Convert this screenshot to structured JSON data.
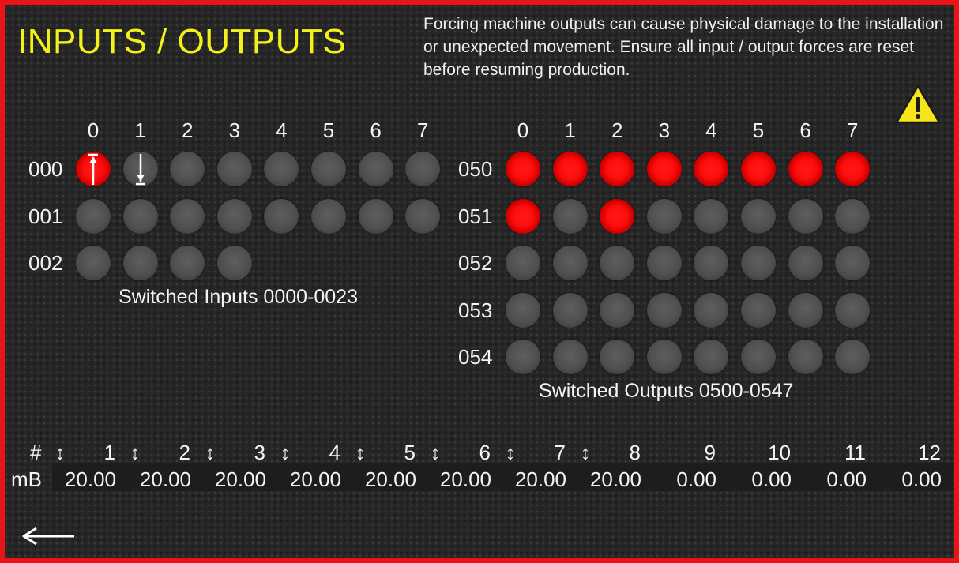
{
  "title": "INPUTS / OUTPUTS",
  "warning": "Forcing machine outputs can cause physical damage to the installation or unexpected movement. Ensure all input / output forces are reset before resuming production.",
  "warning_icon": "warning-triangle-icon",
  "colors": {
    "frame": "#e8141a",
    "title": "#f2f21a",
    "led_on": "#ff0d0d",
    "led_off": "#555555"
  },
  "inputs": {
    "columns": [
      "0",
      "1",
      "2",
      "3",
      "4",
      "5",
      "6",
      "7"
    ],
    "rows": [
      {
        "label": "000",
        "states": [
          1,
          0,
          0,
          0,
          0,
          0,
          0,
          0
        ],
        "forces": [
          "up",
          "down",
          null,
          null,
          null,
          null,
          null,
          null
        ]
      },
      {
        "label": "001",
        "states": [
          0,
          0,
          0,
          0,
          0,
          0,
          0,
          0
        ],
        "forces": [
          null,
          null,
          null,
          null,
          null,
          null,
          null,
          null
        ]
      },
      {
        "label": "002",
        "states": [
          0,
          0,
          0,
          0
        ],
        "forces": [
          null,
          null,
          null,
          null
        ]
      }
    ],
    "caption": "Switched Inputs 0000-0023"
  },
  "outputs": {
    "columns": [
      "0",
      "1",
      "2",
      "3",
      "4",
      "5",
      "6",
      "7"
    ],
    "rows": [
      {
        "label": "050",
        "states": [
          1,
          1,
          1,
          1,
          1,
          1,
          1,
          1
        ]
      },
      {
        "label": "051",
        "states": [
          1,
          0,
          1,
          0,
          0,
          0,
          0,
          0
        ]
      },
      {
        "label": "052",
        "states": [
          0,
          0,
          0,
          0,
          0,
          0,
          0,
          0
        ]
      },
      {
        "label": "053",
        "states": [
          0,
          0,
          0,
          0,
          0,
          0,
          0,
          0
        ]
      },
      {
        "label": "054",
        "states": [
          0,
          0,
          0,
          0,
          0,
          0,
          0,
          0
        ]
      }
    ],
    "caption": "Switched Outputs 0500-0547"
  },
  "analog": {
    "hash_label": "#",
    "unit_label": "mB",
    "channels": [
      {
        "num": "1",
        "arrow": "↕",
        "value": "20.00"
      },
      {
        "num": "2",
        "arrow": "↕",
        "value": "20.00"
      },
      {
        "num": "3",
        "arrow": "↕",
        "value": "20.00"
      },
      {
        "num": "4",
        "arrow": "↕",
        "value": "20.00"
      },
      {
        "num": "5",
        "arrow": "↕",
        "value": "20.00"
      },
      {
        "num": "6",
        "arrow": "↕",
        "value": "20.00"
      },
      {
        "num": "7",
        "arrow": "↕",
        "value": "20.00"
      },
      {
        "num": "8",
        "arrow": "↕",
        "value": "20.00"
      },
      {
        "num": "9",
        "arrow": "",
        "value": "0.00"
      },
      {
        "num": "10",
        "arrow": "",
        "value": "0.00"
      },
      {
        "num": "11",
        "arrow": "",
        "value": "0.00"
      },
      {
        "num": "12",
        "arrow": "",
        "value": "0.00"
      }
    ]
  },
  "back_icon": "back-arrow-icon"
}
